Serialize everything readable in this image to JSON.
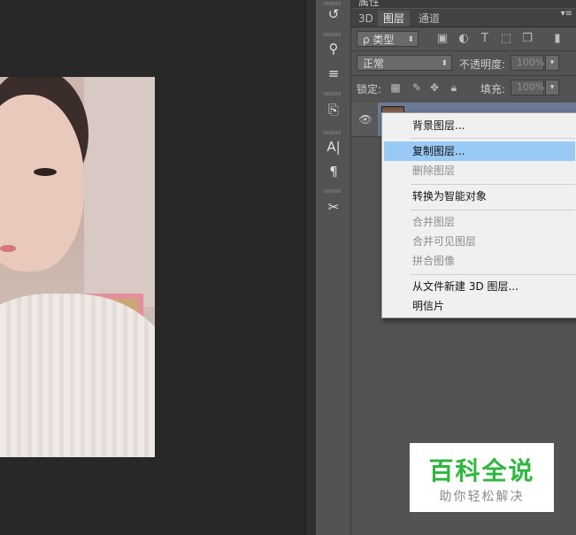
{
  "panel": {
    "title": "属性",
    "tabs": [
      "3D",
      "图层",
      "通道"
    ],
    "menu_icon": "panel-menu-icon",
    "filter_kind": "ρ 类型",
    "blend_mode": "正常",
    "opacity_label": "不透明度:",
    "opacity_value": "100%",
    "lock_label": "锁定:",
    "fill_label": "填充:",
    "fill_value": "100%"
  },
  "tools": {
    "icons": [
      "history-icon",
      "brush-presets-icon",
      "adjustments-icon",
      "clone-source-icon",
      "character-icon",
      "paragraph-icon",
      "tool-presets-icon"
    ],
    "glyphs": [
      "↺",
      "⚲",
      "≡",
      "⎘",
      "A|",
      "¶",
      "✂"
    ]
  },
  "context_menu": {
    "items": [
      {
        "label": "背景图层...",
        "disabled": false
      },
      {
        "label": "复制图层...",
        "disabled": false,
        "highlighted": true
      },
      {
        "label": "删除图层",
        "disabled": true
      },
      {
        "label": "转换为智能对象",
        "disabled": false
      },
      {
        "label": "合并图层",
        "disabled": true
      },
      {
        "label": "合并可见图层",
        "disabled": true
      },
      {
        "label": "拼合图像",
        "disabled": true
      },
      {
        "label": "从文件新建 3D 图层...",
        "disabled": false
      },
      {
        "label": "明信片",
        "disabled": false
      }
    ]
  },
  "watermark": {
    "title": "百科全说",
    "subtitle": "助你轻松解决"
  },
  "colors": {
    "panel_bg": "#535353",
    "menu_highlight": "#99c9f5",
    "watermark_green": "#2fb73e"
  }
}
